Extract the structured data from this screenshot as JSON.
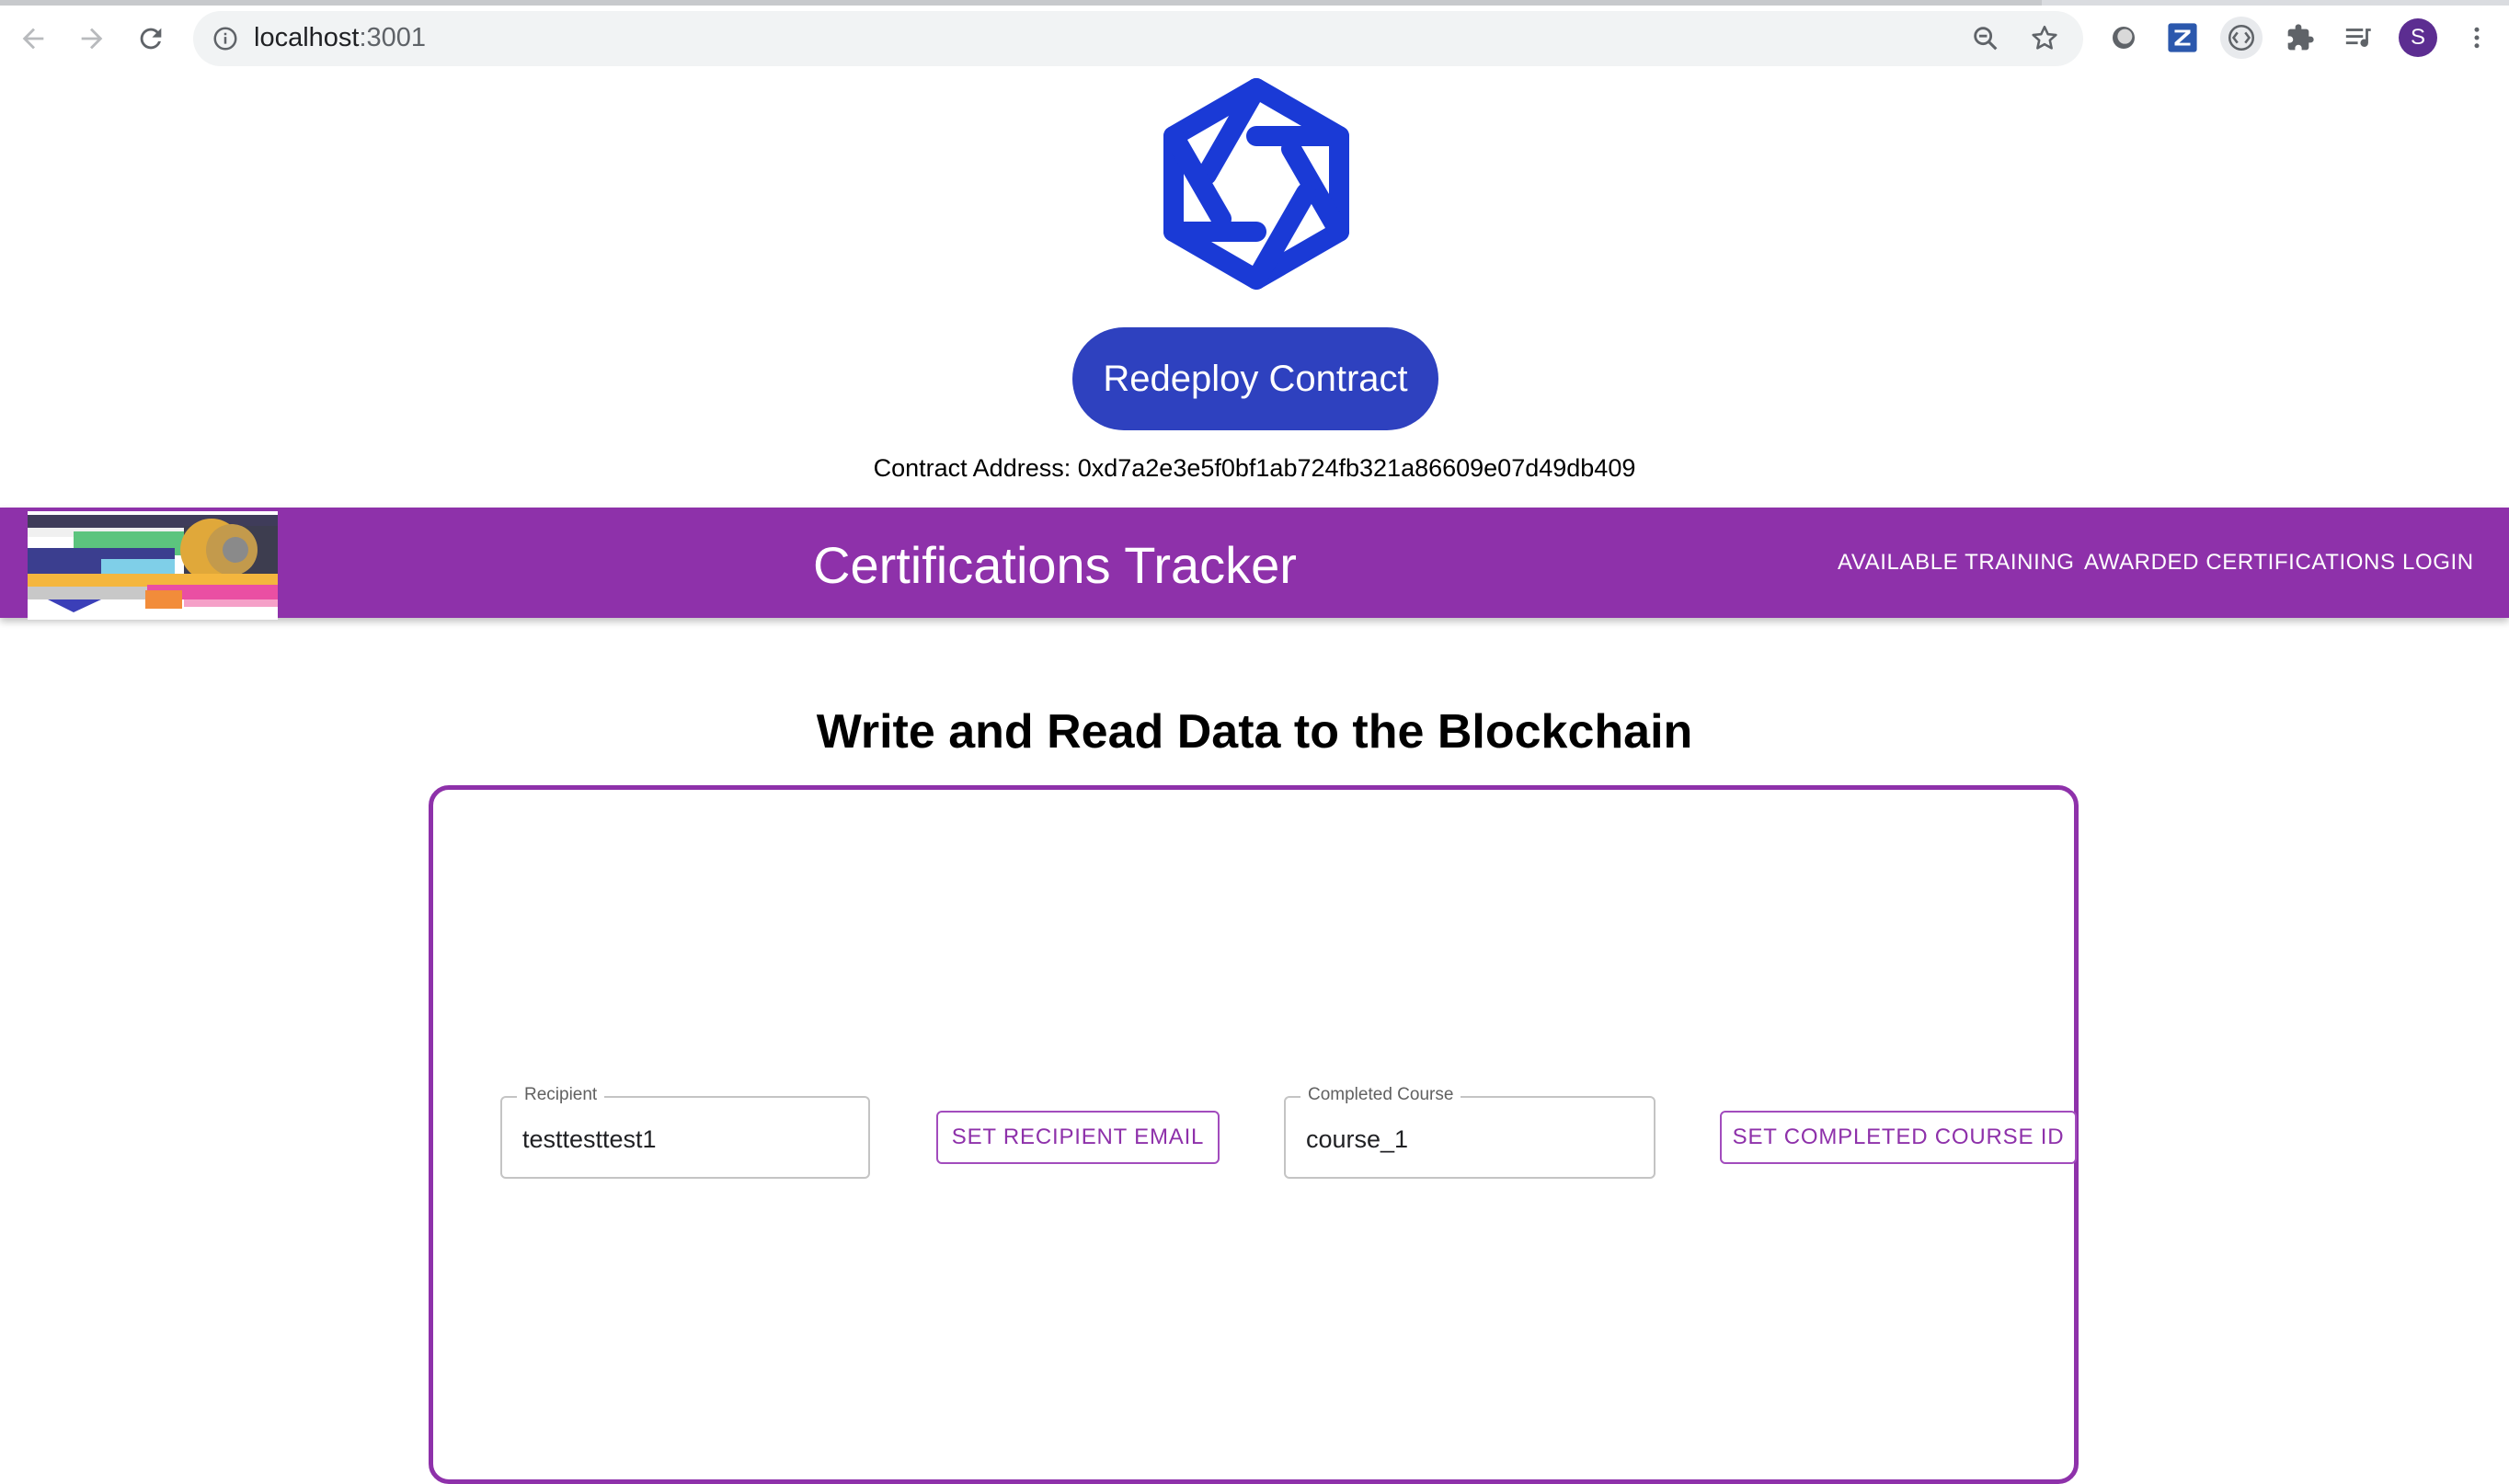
{
  "browser": {
    "url_host": "localhost",
    "url_port": ":3001",
    "profile_initial": "S"
  },
  "hero": {
    "redeploy_label": "Redeploy Contract",
    "contract_line": "Contract Address: 0xd7a2e3e5f0bf1ab724fb321a86609e07d49db409"
  },
  "appbar": {
    "title": "Certifications Tracker",
    "nav": {
      "available_training": "AVAILABLE TRAINING",
      "awarded_certifications": "AWARDED CERTIFICATIONS",
      "login": "LOGIN"
    }
  },
  "main": {
    "heading": "Write and Read Data to the Blockchain",
    "recipient": {
      "label": "Recipient",
      "value": "testtesttest1"
    },
    "set_recipient_button": "SET RECIPIENT EMAIL",
    "completed_course": {
      "label": "Completed Course",
      "value": "course_1"
    },
    "set_course_button": "SET COMPLETED COURSE ID"
  },
  "colors": {
    "appbar": "#8e31aa",
    "primary_button": "#2e41bf",
    "logo": "#1a3ad6"
  }
}
